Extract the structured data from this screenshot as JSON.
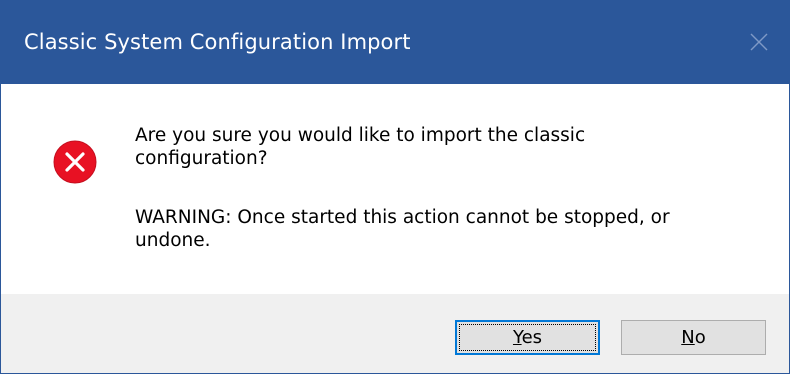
{
  "dialog": {
    "title": "Classic System Configuration Import",
    "close_icon": "close-icon",
    "message_line1": "Are you sure you would like to import the classic configuration?",
    "message_line2": "WARNING: Once started this action cannot be stopped, or undone.",
    "icon": "error-icon",
    "buttons": {
      "yes_accel": "Y",
      "yes_rest": "es",
      "no_accel": "N",
      "no_rest": "o"
    }
  },
  "colors": {
    "titlebar": "#2b579a",
    "error_icon": "#e81123",
    "button_focus": "#0078d7",
    "footer": "#f0f0f0"
  }
}
